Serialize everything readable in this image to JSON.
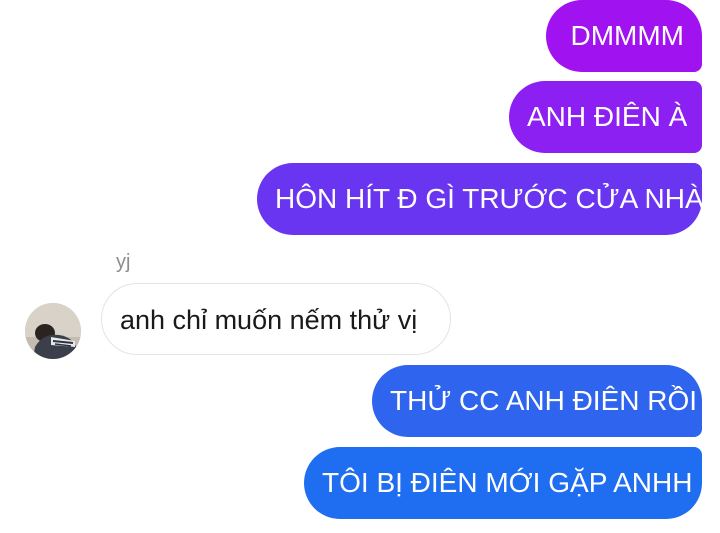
{
  "chat": {
    "messages": [
      {
        "direction": "outgoing",
        "text": "DMMMM"
      },
      {
        "direction": "outgoing",
        "text": "ANH ĐIÊN À"
      },
      {
        "direction": "outgoing",
        "text": "HÔN HÍT Đ GÌ TRƯỚC CỬA NHÀ"
      },
      {
        "direction": "incoming",
        "sender": "yj",
        "text": "anh chỉ muốn nếm thử vị"
      },
      {
        "direction": "outgoing",
        "text": "THỬ CC ANH ĐIÊN RỒI"
      },
      {
        "direction": "outgoing",
        "text": "TÔI BỊ ĐIÊN MỚI GẶP ANHH"
      }
    ]
  },
  "colors": {
    "outgoing_gradient_top": "#a012ef",
    "outgoing_gradient_bottom": "#1f6df0",
    "incoming_bubble": "#ffffff",
    "sender_name": "#8e8e8e"
  },
  "icons": {
    "avatar": "user-photo-avatar"
  }
}
